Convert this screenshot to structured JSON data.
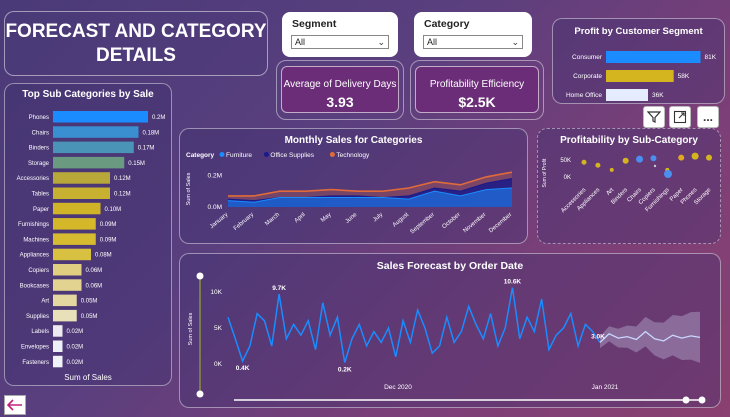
{
  "header": {
    "title_line1": "FORECAST AND CATEGORY",
    "title_line2": "DETAILS"
  },
  "slicers": {
    "segment": {
      "label": "Segment",
      "value": "All"
    },
    "category": {
      "label": "Category",
      "value": "All"
    }
  },
  "kpis": {
    "delivery": {
      "label": "Average of Delivery Days",
      "value": "3.93"
    },
    "profitability": {
      "label": "Profitability Efficiency",
      "value": "$2.5K"
    }
  },
  "profit_segment": {
    "title": "Profit by Customer Segment",
    "rows": [
      {
        "label": "Consumer",
        "value_label": "81K",
        "value": 81,
        "color": "#1a8cff"
      },
      {
        "label": "Corporate",
        "value_label": "58K",
        "value": 58,
        "color": "#d4b520"
      },
      {
        "label": "Home Office",
        "value_label": "36K",
        "value": 36,
        "color": "#e6ecff"
      }
    ]
  },
  "subcat_sales": {
    "title": "Top Sub Categories by Sale",
    "xlabel": "Sum of Sales",
    "rows": [
      {
        "label": "Phones",
        "value": 0.2,
        "value_label": "0.2M",
        "color": "#1a8cff"
      },
      {
        "label": "Chairs",
        "value": 0.18,
        "value_label": "0.18M",
        "color": "#3a8fd0"
      },
      {
        "label": "Binders",
        "value": 0.17,
        "value_label": "0.17M",
        "color": "#4a94b8"
      },
      {
        "label": "Storage",
        "value": 0.15,
        "value_label": "0.15M",
        "color": "#6a9a80"
      },
      {
        "label": "Accessories",
        "value": 0.12,
        "value_label": "0.12M",
        "color": "#b8a83a"
      },
      {
        "label": "Tables",
        "value": 0.12,
        "value_label": "0.12M",
        "color": "#c8b030"
      },
      {
        "label": "Paper",
        "value": 0.1,
        "value_label": "0.10M",
        "color": "#d0b428"
      },
      {
        "label": "Furnishings",
        "value": 0.09,
        "value_label": "0.09M",
        "color": "#d4b82a"
      },
      {
        "label": "Machines",
        "value": 0.09,
        "value_label": "0.09M",
        "color": "#d6ba30"
      },
      {
        "label": "Appliances",
        "value": 0.08,
        "value_label": "0.08M",
        "color": "#d8c040"
      },
      {
        "label": "Copiers",
        "value": 0.06,
        "value_label": "0.06M",
        "color": "#e0cf80"
      },
      {
        "label": "Bookcases",
        "value": 0.06,
        "value_label": "0.06M",
        "color": "#e2d490"
      },
      {
        "label": "Art",
        "value": 0.05,
        "value_label": "0.05M",
        "color": "#e4d8a0"
      },
      {
        "label": "Supplies",
        "value": 0.05,
        "value_label": "0.05M",
        "color": "#e8e0b8"
      },
      {
        "label": "Labels",
        "value": 0.02,
        "value_label": "0.02M",
        "color": "#eceaf0"
      },
      {
        "label": "Envelopes",
        "value": 0.02,
        "value_label": "0.02M",
        "color": "#eef0f8"
      },
      {
        "label": "Fasteners",
        "value": 0.02,
        "value_label": "0.02M",
        "color": "#f0f2fa"
      }
    ]
  },
  "monthly": {
    "title": "Monthly Sales for Categories",
    "legend_label": "Category",
    "ylabel": "Sum of Sales",
    "yticks": [
      "0.2M",
      "0.0M"
    ],
    "months": [
      "January",
      "February",
      "March",
      "April",
      "May",
      "June",
      "July",
      "August",
      "September",
      "October",
      "November",
      "December"
    ],
    "series": [
      {
        "name": "Furniture",
        "color": "#1a8cff",
        "values": [
          0.04,
          0.03,
          0.06,
          0.06,
          0.06,
          0.06,
          0.06,
          0.05,
          0.1,
          0.07,
          0.11,
          0.12
        ]
      },
      {
        "name": "Office Supplies",
        "color": "#1a1a8a",
        "values": [
          0.05,
          0.04,
          0.06,
          0.06,
          0.07,
          0.07,
          0.06,
          0.07,
          0.12,
          0.1,
          0.15,
          0.18
        ]
      },
      {
        "name": "Technology",
        "color": "#e06b3a",
        "values": [
          0.07,
          0.07,
          0.1,
          0.1,
          0.11,
          0.1,
          0.1,
          0.12,
          0.16,
          0.14,
          0.19,
          0.22
        ]
      }
    ]
  },
  "profit_subcat": {
    "title": "Profitability by Sub-Category",
    "ylabel": "Sum of Profit",
    "yticks": [
      "50K",
      "0K"
    ],
    "categories": [
      "Accessories",
      "Appliances",
      "Art",
      "Binders",
      "Chairs",
      "Copiers",
      "Furnishings",
      "Paper",
      "Phones",
      "Storage"
    ]
  },
  "forecast": {
    "title": "Sales Forecast by Order Date",
    "ylabel": "Sum of Sales",
    "yticks": [
      "10K",
      "5K",
      "0K"
    ],
    "xticks": [
      "Dec 2020",
      "Jan 2021"
    ],
    "labels": [
      "9.7K",
      "10.6K",
      "0.4K",
      "0.2K",
      "3.0K"
    ]
  },
  "toolbar": {
    "filter": "filter-icon",
    "focus": "focus-mode-icon",
    "more": "..."
  },
  "nav": {
    "back": "back-arrow-icon"
  }
}
